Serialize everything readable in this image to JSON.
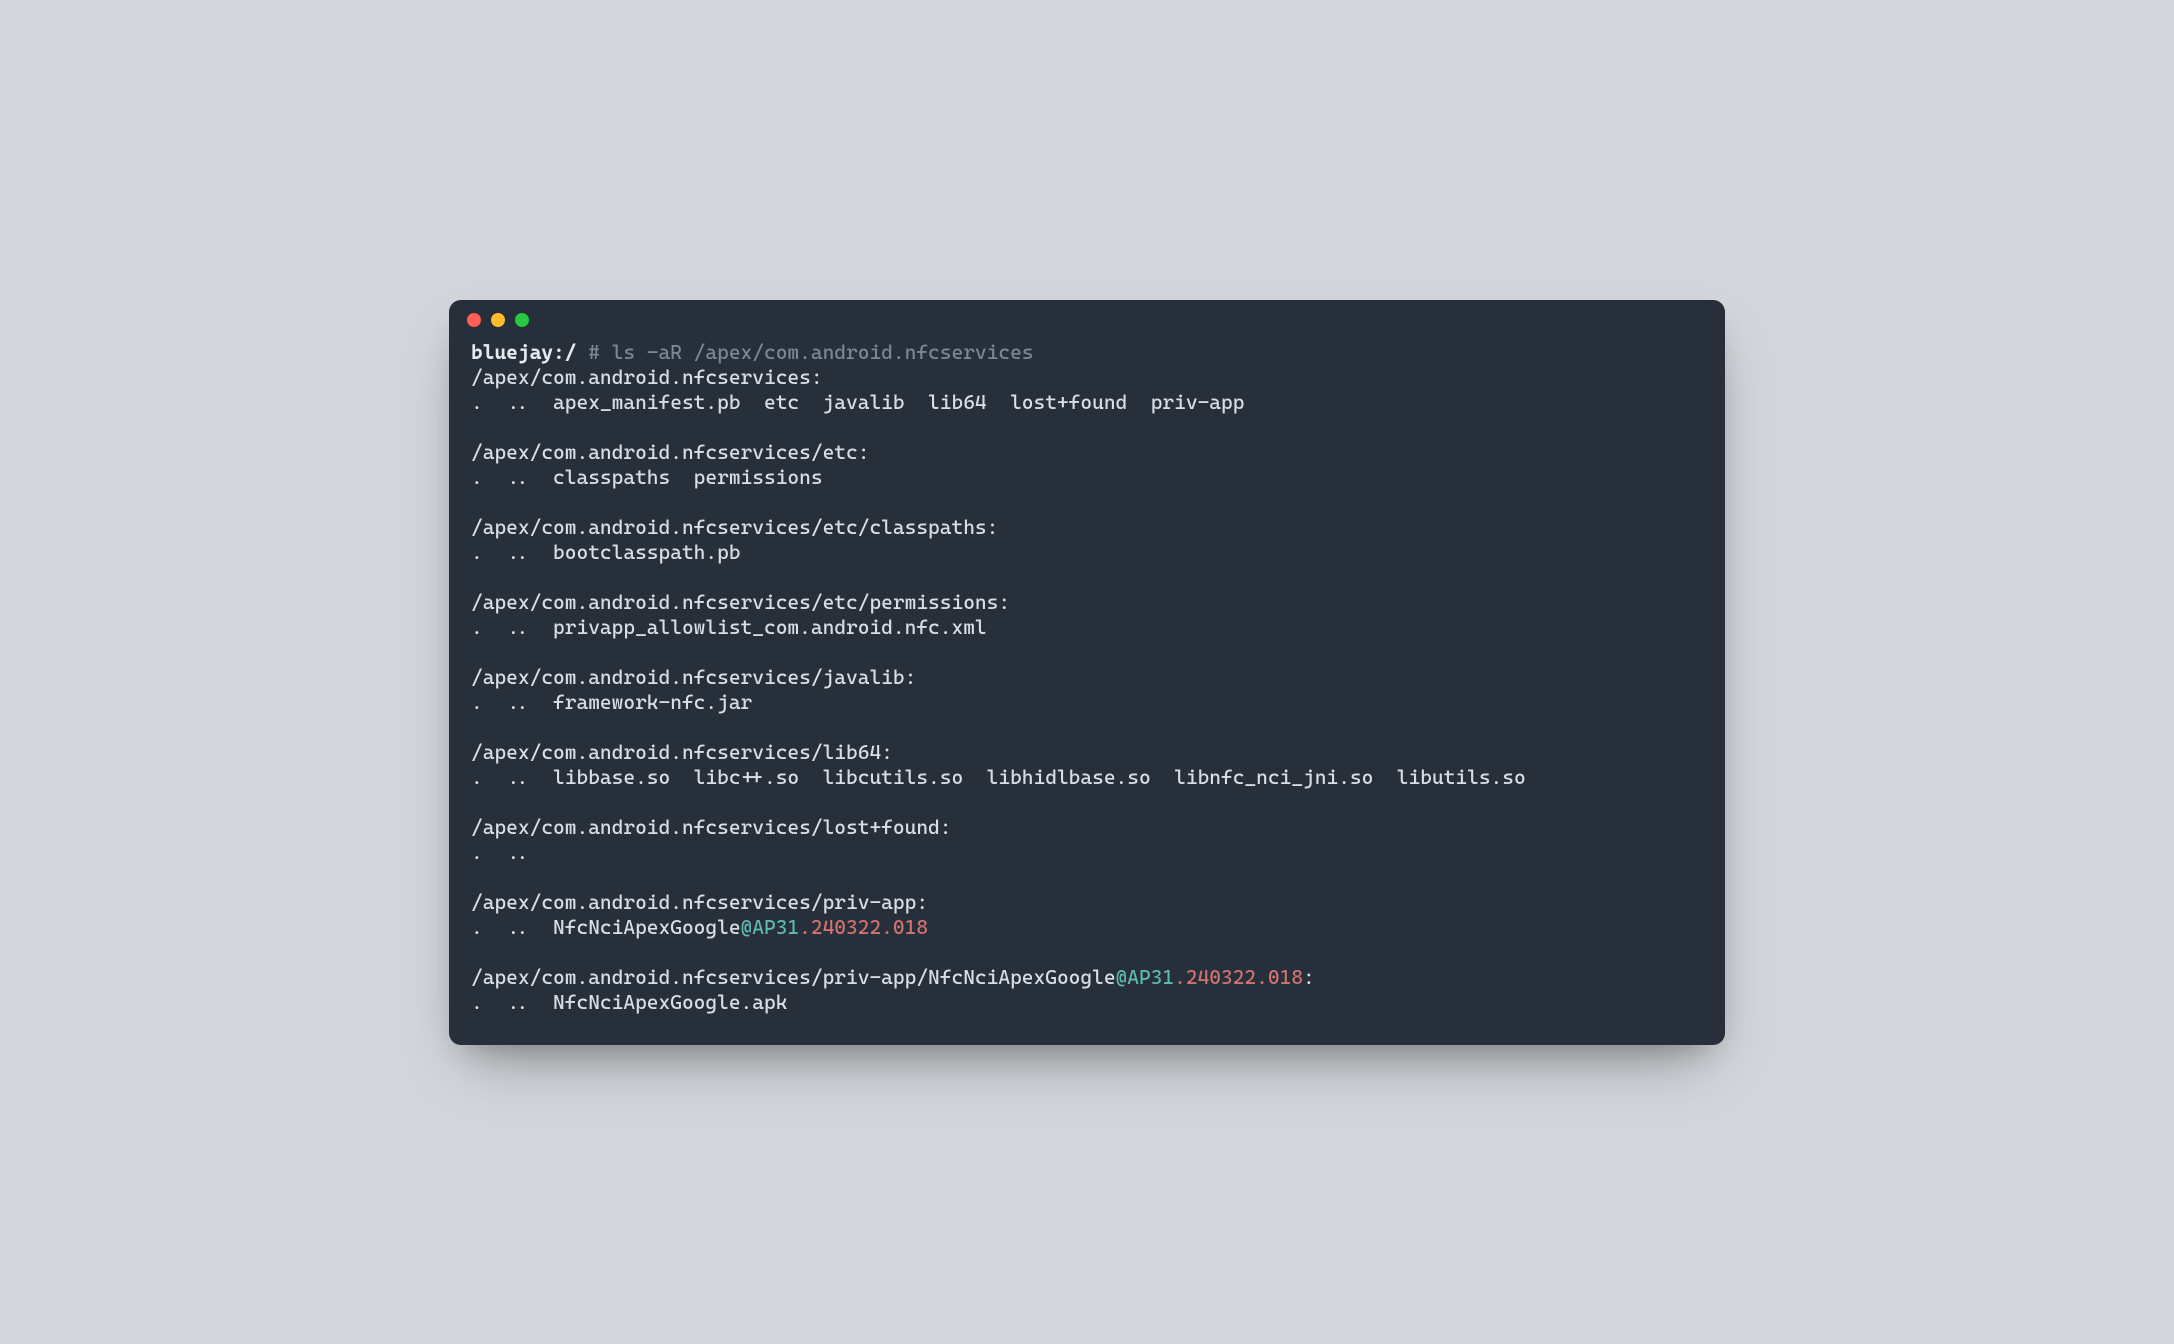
{
  "prompt": {
    "host": "bluejay:/",
    "command": "# ls -aR /apex/com.android.nfcservices"
  },
  "lines": [
    {
      "segs": [
        {
          "t": "/apex/com.android.nfcservices:"
        }
      ]
    },
    {
      "segs": [
        {
          "t": ".  ..  apex_manifest.pb  etc  javalib  lib64  lost+found  priv-app"
        }
      ]
    },
    {
      "segs": [
        {
          "t": ""
        }
      ]
    },
    {
      "segs": [
        {
          "t": "/apex/com.android.nfcservices/etc:"
        }
      ]
    },
    {
      "segs": [
        {
          "t": ".  ..  classpaths  permissions"
        }
      ]
    },
    {
      "segs": [
        {
          "t": ""
        }
      ]
    },
    {
      "segs": [
        {
          "t": "/apex/com.android.nfcservices/etc/classpaths:"
        }
      ]
    },
    {
      "segs": [
        {
          "t": ".  ..  bootclasspath.pb"
        }
      ]
    },
    {
      "segs": [
        {
          "t": ""
        }
      ]
    },
    {
      "segs": [
        {
          "t": "/apex/com.android.nfcservices/etc/permissions:"
        }
      ]
    },
    {
      "segs": [
        {
          "t": ".  ..  privapp_allowlist_com.android.nfc.xml"
        }
      ]
    },
    {
      "segs": [
        {
          "t": ""
        }
      ]
    },
    {
      "segs": [
        {
          "t": "/apex/com.android.nfcservices/javalib:"
        }
      ]
    },
    {
      "segs": [
        {
          "t": ".  ..  framework-nfc.jar"
        }
      ]
    },
    {
      "segs": [
        {
          "t": ""
        }
      ]
    },
    {
      "segs": [
        {
          "t": "/apex/com.android.nfcservices/lib64:"
        }
      ]
    },
    {
      "segs": [
        {
          "t": ".  ..  libbase.so  libc++.so  libcutils.so  libhidlbase.so  libnfc_nci_jni.so  libutils.so"
        }
      ]
    },
    {
      "segs": [
        {
          "t": ""
        }
      ]
    },
    {
      "segs": [
        {
          "t": "/apex/com.android.nfcservices/lost+found:"
        }
      ]
    },
    {
      "segs": [
        {
          "t": ".  .."
        }
      ]
    },
    {
      "segs": [
        {
          "t": ""
        }
      ]
    },
    {
      "segs": [
        {
          "t": "/apex/com.android.nfcservices/priv-app:"
        }
      ]
    },
    {
      "segs": [
        {
          "t": ".  ..  NfcNciApexGoogle"
        },
        {
          "t": "@AP31",
          "c": "cyan"
        },
        {
          "t": ".240322.018",
          "c": "red"
        }
      ]
    },
    {
      "segs": [
        {
          "t": ""
        }
      ]
    },
    {
      "segs": [
        {
          "t": "/apex/com.android.nfcservices/priv-app/NfcNciApexGoogle"
        },
        {
          "t": "@AP31",
          "c": "cyan"
        },
        {
          "t": ".240322.018",
          "c": "red"
        },
        {
          "t": ":"
        }
      ]
    },
    {
      "segs": [
        {
          "t": ".  ..  NfcNciApexGoogle.apk"
        }
      ]
    }
  ]
}
